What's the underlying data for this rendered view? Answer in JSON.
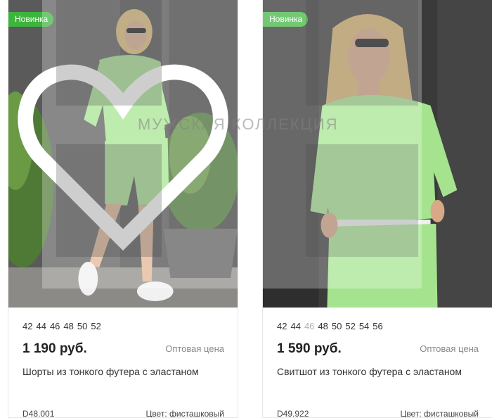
{
  "colors": {
    "badge": "#3db43d",
    "price": "#222222",
    "muted": "#8a8a8a",
    "outfit": "#a6e38f"
  },
  "overlay": {
    "text": "МУЖСКАЯ КОЛЛЕКЦИЯ"
  },
  "products": [
    {
      "badge": "Новинка",
      "sizes": [
        {
          "label": "42",
          "available": true
        },
        {
          "label": "44",
          "available": true
        },
        {
          "label": "46",
          "available": true
        },
        {
          "label": "48",
          "available": true
        },
        {
          "label": "50",
          "available": true
        },
        {
          "label": "52",
          "available": true
        }
      ],
      "price": "1 190 руб.",
      "wholesale": "Оптовая цена",
      "title": "Шорты из тонкого футера с эластаном",
      "sku": "D48.001",
      "color": "Цвет: фисташковый",
      "icons": {
        "favorite": "heart-icon"
      }
    },
    {
      "badge": "Новинка",
      "sizes": [
        {
          "label": "42",
          "available": true
        },
        {
          "label": "44",
          "available": true
        },
        {
          "label": "46",
          "available": false
        },
        {
          "label": "48",
          "available": true
        },
        {
          "label": "50",
          "available": true
        },
        {
          "label": "52",
          "available": true
        },
        {
          "label": "54",
          "available": true
        },
        {
          "label": "56",
          "available": true
        }
      ],
      "price": "1 590 руб.",
      "wholesale": "Оптовая цена",
      "title": "Свитшот из тонкого футера с эластаном",
      "sku": "D49.922",
      "color": "Цвет: фисташковый",
      "icons": {
        "favorite": "heart-icon"
      }
    }
  ]
}
